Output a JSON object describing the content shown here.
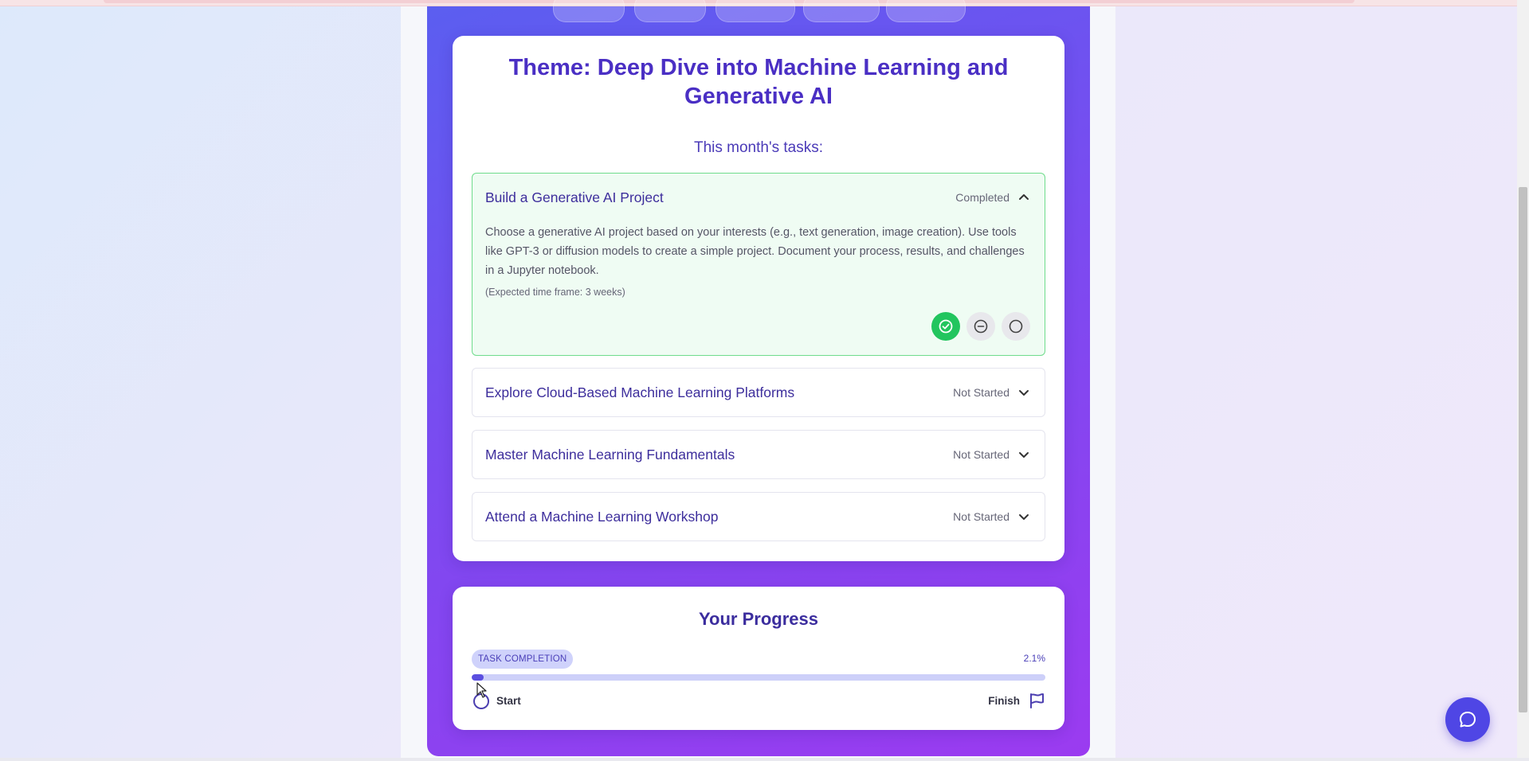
{
  "theme": {
    "title": "Theme: Deep Dive into Machine Learning and Generative AI",
    "tasks_heading": "This month's tasks:"
  },
  "tasks": [
    {
      "title": "Build a Generative AI Project",
      "status": "Completed",
      "expanded": true,
      "description": "Choose a generative AI project based on your interests (e.g., text generation, image creation). Use tools like GPT-3 or diffusion models to create a simple project. Document your process, results, and challenges in a Jupyter notebook.",
      "note": "(Expected time frame: 3 weeks)"
    },
    {
      "title": "Explore Cloud-Based Machine Learning Platforms",
      "status": "Not Started",
      "expanded": false
    },
    {
      "title": "Master Machine Learning Fundamentals",
      "status": "Not Started",
      "expanded": false
    },
    {
      "title": "Attend a Machine Learning Workshop",
      "status": "Not Started",
      "expanded": false
    }
  ],
  "progress": {
    "title": "Your Progress",
    "label": "TASK COMPLETION",
    "percent_text": "2.1%",
    "percent": 2.1,
    "start_label": "Start",
    "finish_label": "Finish"
  },
  "colors": {
    "accent": "#4f46e5",
    "completed": "#22c55e",
    "title": "#4a2fc4"
  },
  "icons": {
    "expand": "chevron-up-icon",
    "collapse": "chevron-down-icon",
    "status_completed": "check-circle-icon",
    "status_in_progress": "minus-circle-icon",
    "status_not_started": "circle-icon",
    "chat": "chat-bubble-icon",
    "finish": "flag-icon",
    "start": "circle-icon"
  }
}
